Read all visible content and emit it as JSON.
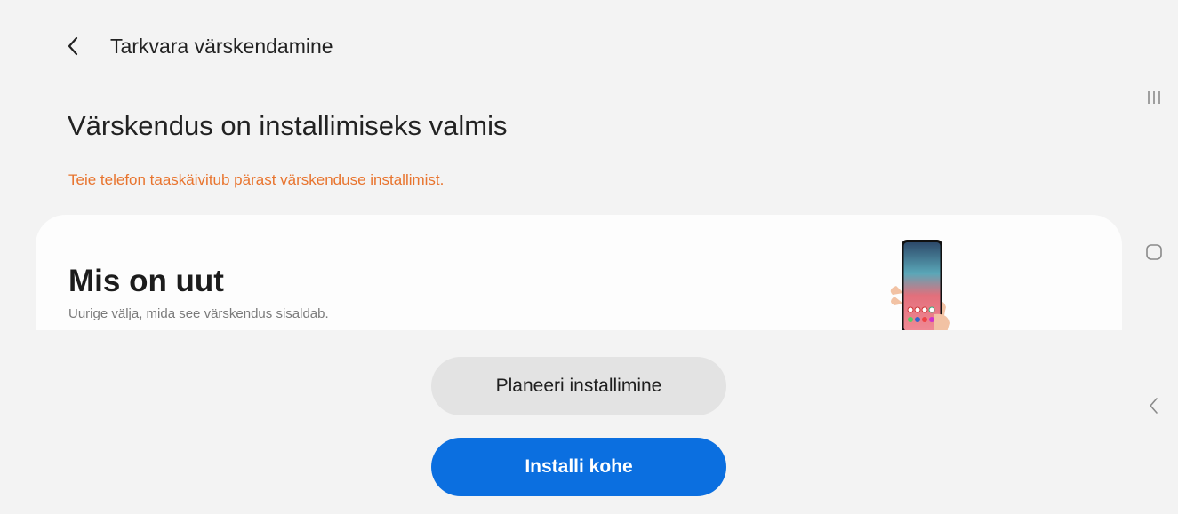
{
  "header": {
    "title": "Tarkvara värskendamine",
    "back_icon": "chevron-left-icon"
  },
  "main": {
    "title": "Värskendus on installimiseks valmis",
    "warning": "Teie telefon taaskäivitub pärast värskenduse installimist.",
    "warning_color": "#e8742e"
  },
  "whats_new": {
    "title": "Mis on uut",
    "subtitle": "Uurige välja, mida see värskendus sisaldab.",
    "image_icon": "phone-in-hand-illustration"
  },
  "actions": {
    "schedule_label": "Planeeri installimine",
    "install_now_label": "Installi kohe",
    "primary_color": "#0b6fe0"
  },
  "navbar": {
    "recents_icon": "recent-apps-icon",
    "home_icon": "home-icon",
    "back_icon": "back-icon"
  }
}
